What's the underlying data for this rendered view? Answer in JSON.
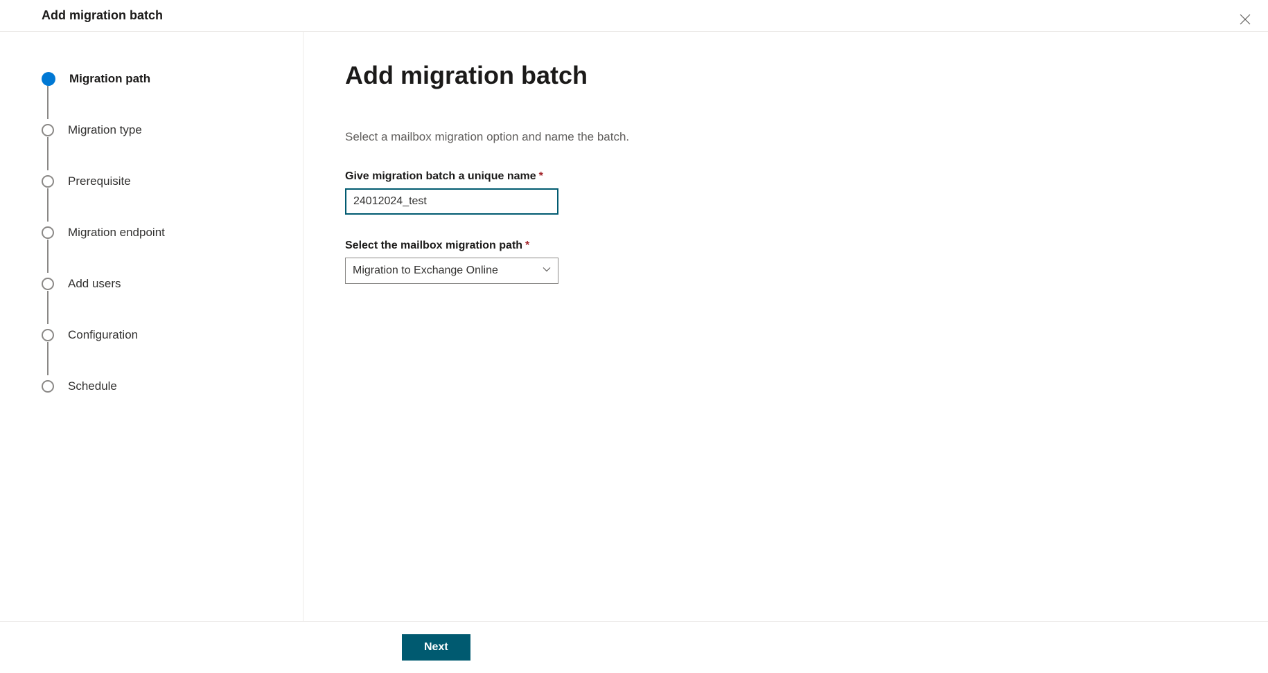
{
  "header": {
    "title": "Add migration batch"
  },
  "steps": [
    {
      "label": "Migration path",
      "active": true
    },
    {
      "label": "Migration type",
      "active": false
    },
    {
      "label": "Prerequisite",
      "active": false
    },
    {
      "label": "Migration endpoint",
      "active": false
    },
    {
      "label": "Add users",
      "active": false
    },
    {
      "label": "Configuration",
      "active": false
    },
    {
      "label": "Schedule",
      "active": false
    }
  ],
  "main": {
    "title": "Add migration batch",
    "description": "Select a mailbox migration option and name the batch.",
    "name_label": "Give migration batch a unique name",
    "name_value": "24012024_test",
    "path_label": "Select the mailbox migration path",
    "path_value": "Migration to Exchange Online"
  },
  "footer": {
    "next_label": "Next"
  }
}
